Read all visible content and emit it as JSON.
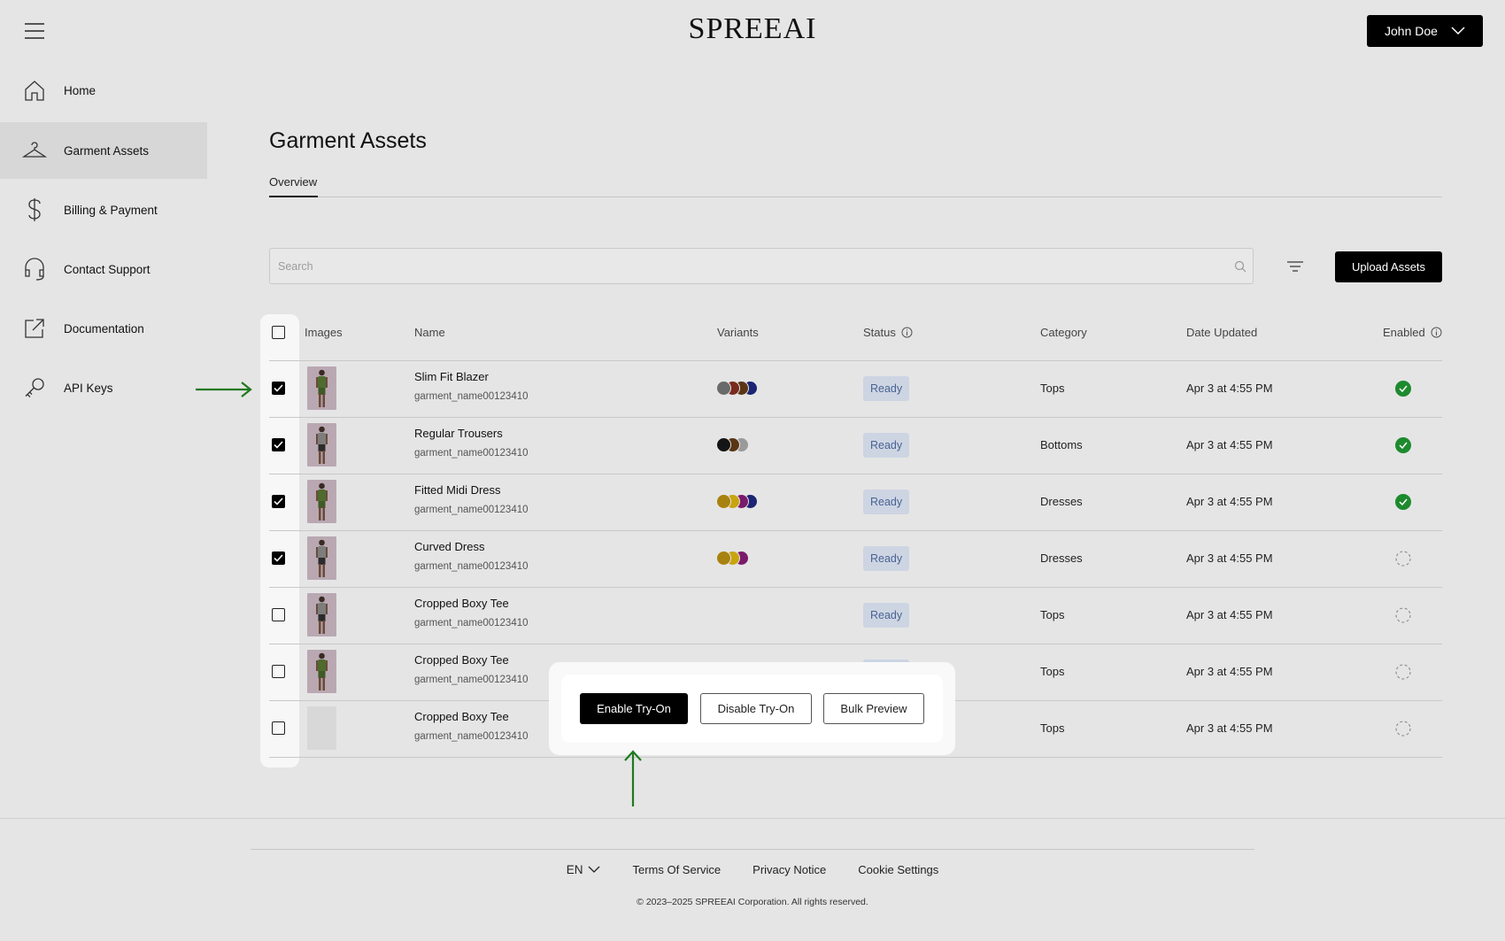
{
  "header": {
    "logo": "SPREEAI",
    "user_name": "John Doe"
  },
  "sidebar": {
    "items": [
      {
        "label": "Home",
        "icon": "home-icon"
      },
      {
        "label": "Garment Assets",
        "icon": "hanger-icon",
        "active": true
      },
      {
        "label": "Billing & Payment",
        "icon": "dollar-icon"
      },
      {
        "label": "Contact Support",
        "icon": "headset-icon"
      },
      {
        "label": "Documentation",
        "icon": "external-link-icon"
      },
      {
        "label": "API Keys",
        "icon": "key-icon"
      }
    ]
  },
  "main": {
    "title": "Garment Assets",
    "tabs": [
      {
        "label": "Overview",
        "active": true
      }
    ],
    "search": {
      "placeholder": "Search"
    },
    "upload_label": "Upload Assets"
  },
  "table": {
    "headers": {
      "images": "Images",
      "name": "Name",
      "variants": "Variants",
      "status": "Status",
      "category": "Category",
      "date": "Date Updated",
      "enabled": "Enabled"
    },
    "rows": [
      {
        "name": "Slim Fit Blazer",
        "id": "garment_name00123410",
        "checked": true,
        "variants": [
          "#6a6a6a",
          "#7a2a1f",
          "#5a3514",
          "#1c2474"
        ],
        "status": "Ready",
        "category": "Tops",
        "date": "Apr 3 at 4:55 PM",
        "enabled": true,
        "thumb": "green"
      },
      {
        "name": "Regular Trousers",
        "id": "garment_name00123410",
        "checked": true,
        "variants": [
          "#151515",
          "#5a3514",
          "#9a9a9a"
        ],
        "status": "Ready",
        "category": "Bottoms",
        "date": "Apr 3 at 4:55 PM",
        "enabled": true,
        "thumb": "grey"
      },
      {
        "name": "Fitted Midi Dress",
        "id": "garment_name00123410",
        "checked": true,
        "variants": [
          "#a88210",
          "#c9a40f",
          "#7a1a6a",
          "#1c2474"
        ],
        "status": "Ready",
        "category": "Dresses",
        "date": "Apr 3 at 4:55 PM",
        "enabled": true,
        "thumb": "green"
      },
      {
        "name": "Curved Dress",
        "id": "garment_name00123410",
        "checked": true,
        "variants": [
          "#a88210",
          "#c9a40f",
          "#7a1a6a"
        ],
        "status": "Ready",
        "category": "Dresses",
        "date": "Apr 3 at 4:55 PM",
        "enabled": false,
        "thumb": "grey"
      },
      {
        "name": "Cropped Boxy Tee",
        "id": "garment_name00123410",
        "checked": false,
        "variants": [],
        "status": "Ready",
        "category": "Tops",
        "date": "Apr 3 at 4:55 PM",
        "enabled": false,
        "thumb": "grey"
      },
      {
        "name": "Cropped Boxy Tee",
        "id": "garment_name00123410",
        "checked": false,
        "variants": [],
        "status": "Ready",
        "category": "Tops",
        "date": "Apr 3 at 4:55 PM",
        "enabled": false,
        "thumb": "green"
      },
      {
        "name": "Cropped Boxy Tee",
        "id": "garment_name00123410",
        "checked": false,
        "variants": [],
        "status": "",
        "category": "Tops",
        "date": "Apr 3 at 4:55 PM",
        "enabled": false,
        "thumb": "empty"
      }
    ]
  },
  "bulk_actions": {
    "enable_label": "Enable Try-On",
    "disable_label": "Disable Try-On",
    "preview_label": "Bulk Preview"
  },
  "footer": {
    "language": "EN",
    "links": [
      "Terms Of Service",
      "Privacy Notice",
      "Cookie Settings"
    ],
    "copyright": "© 2023–2025 SPREEAI Corporation. All rights reserved."
  },
  "colors": {
    "accent": "#000000",
    "status_bg": "#cdd5e3",
    "status_text": "#4a6393",
    "enabled": "#1e8a2e",
    "annotation_arrow": "#1f7a1f"
  }
}
